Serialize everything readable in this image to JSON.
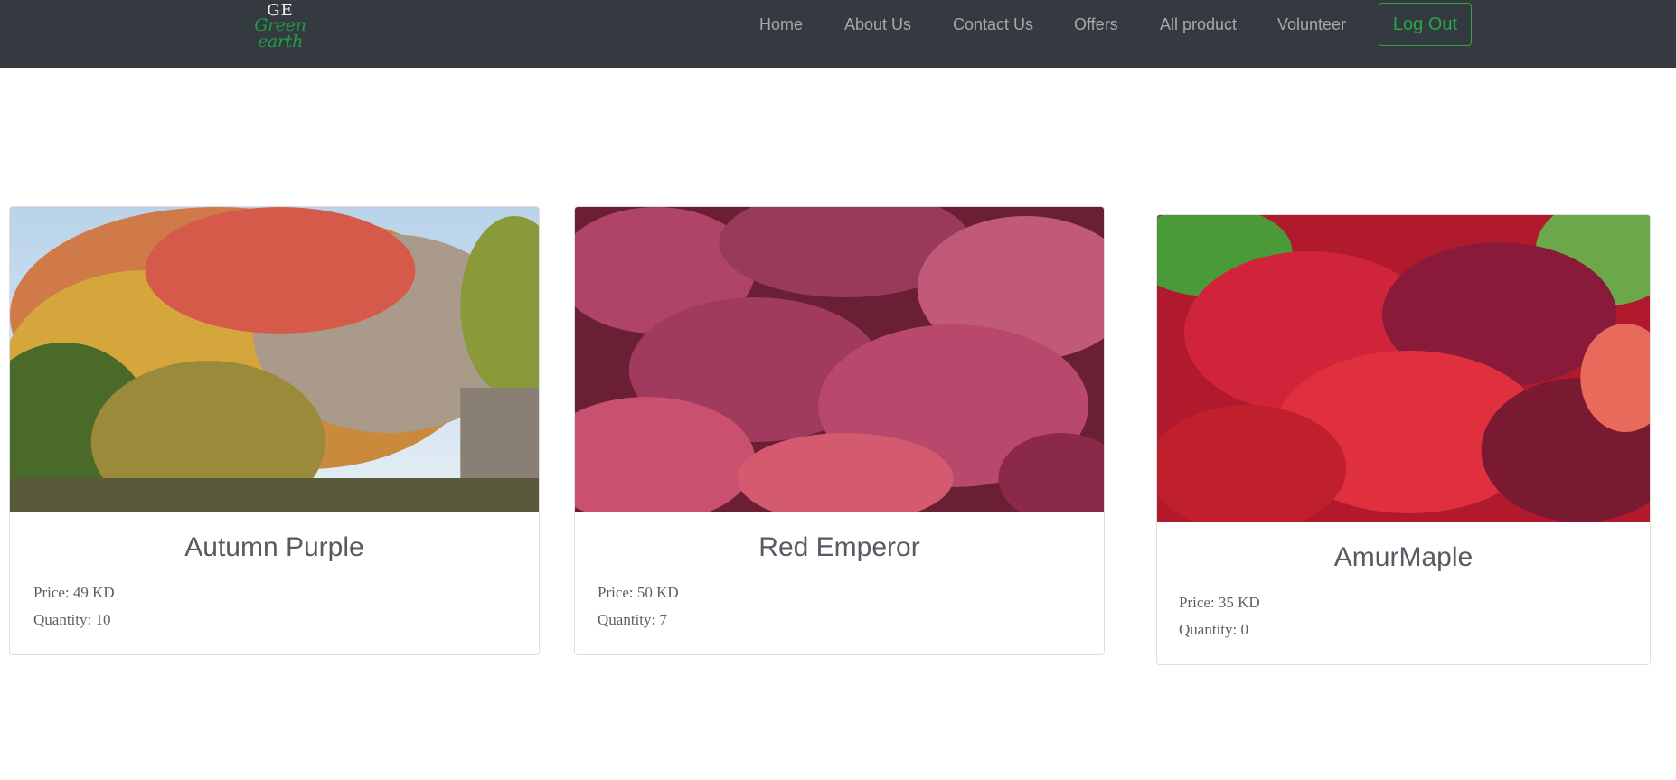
{
  "brand": {
    "monogram": "GE",
    "name": "Green earth"
  },
  "nav": {
    "items": [
      "Home",
      "About Us",
      "Contact Us",
      "Offers",
      "All product",
      "Volunteer"
    ],
    "logout_label": "Log Out"
  },
  "colors": {
    "navbar_bg": "#343a40",
    "brand_green": "#1f9e47",
    "logout_green": "#28a745"
  },
  "products": [
    {
      "name": "Autumn Purple",
      "price": "Price: 49 KD",
      "quantity": "Quantity: 10"
    },
    {
      "name": "Red Emperor",
      "price": "Price: 50 KD",
      "quantity": "Quantity: 7"
    },
    {
      "name": "AmurMaple",
      "price": "Price: 35 KD",
      "quantity": "Quantity: 0"
    }
  ]
}
